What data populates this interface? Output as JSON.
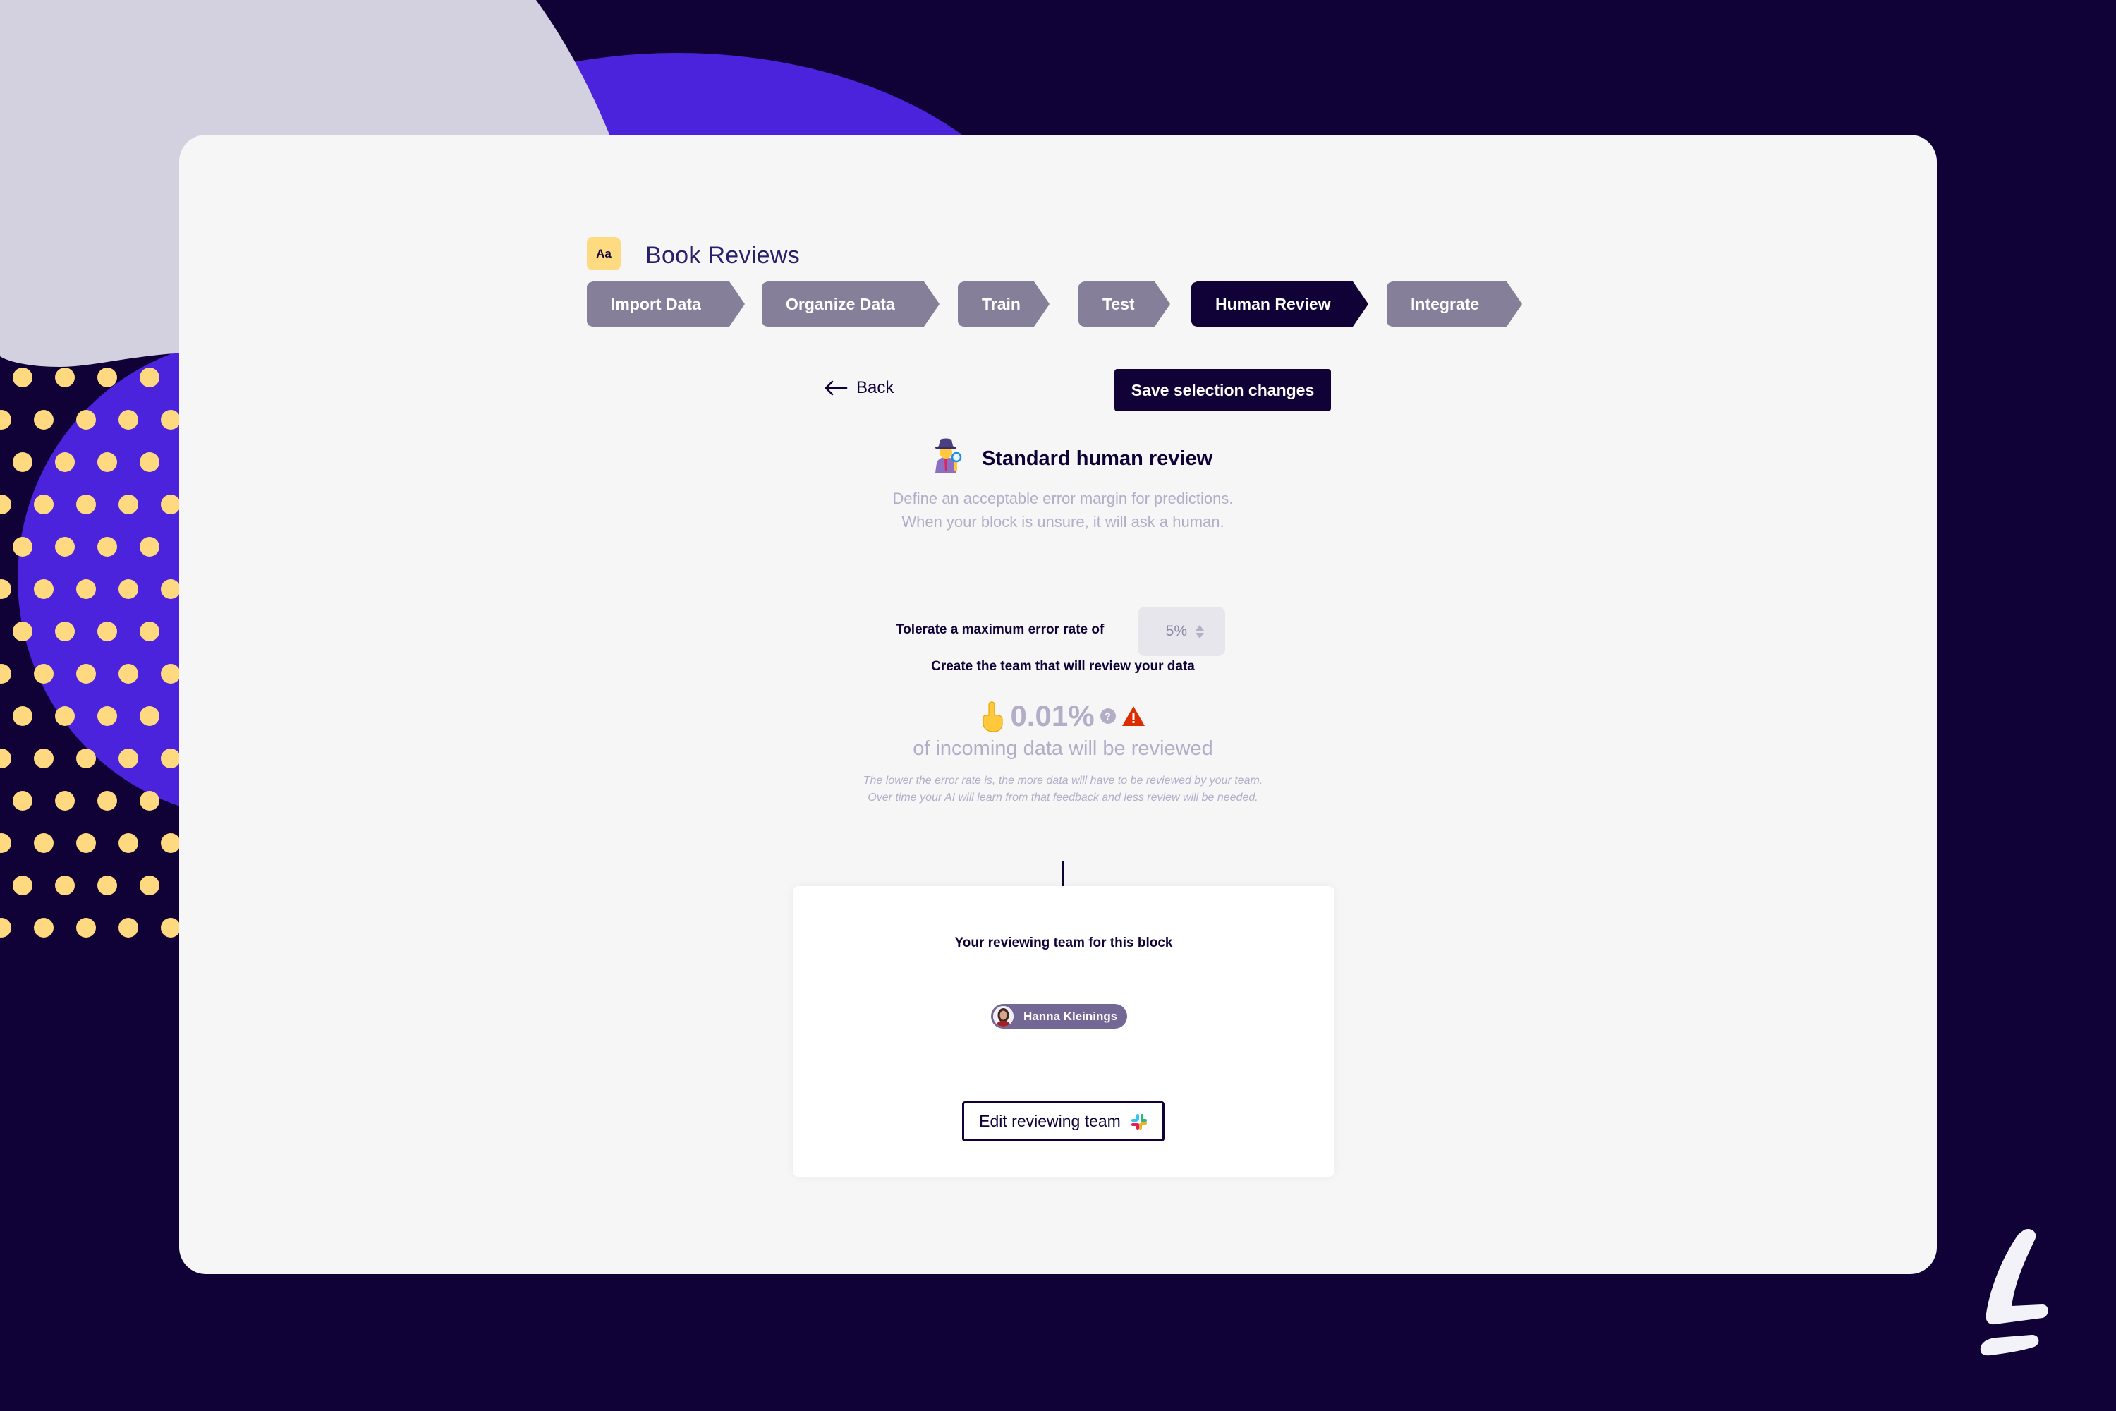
{
  "project": {
    "icon_label": "Aa",
    "title": "Book Reviews"
  },
  "steps": [
    {
      "label": "Import Data",
      "active": false
    },
    {
      "label": "Organize Data",
      "active": false
    },
    {
      "label": "Train",
      "active": false
    },
    {
      "label": "Test",
      "active": false
    },
    {
      "label": "Human Review",
      "active": true
    },
    {
      "label": "Integrate",
      "active": false
    }
  ],
  "toolbar": {
    "back_label": "Back",
    "save_label": "Save selection changes"
  },
  "review_mode": {
    "emoji": "🕵️‍♀️",
    "title": "Standard human review",
    "description_line1": "Define an acceptable error margin for predictions.",
    "description_line2": "When your block is unsure, it will ask a human."
  },
  "error_rate": {
    "label": "Tolerate a maximum error rate of",
    "value": "5%",
    "create_team_label": "Create the team that will review your data"
  },
  "estimate": {
    "emoji": "☝️",
    "percent": "0.01%",
    "help_glyph": "?",
    "caption": "of incoming data will be reviewed",
    "note": "The lower the error rate is, the more data will have to be reviewed by your team. Over time your AI will learn from that feedback and less review will be needed."
  },
  "team_panel": {
    "title": "Your reviewing team for this block",
    "members": [
      {
        "name": "Hanna Kleinings"
      }
    ],
    "edit_label": "Edit reviewing team"
  },
  "colors": {
    "background": "#100236",
    "accent_purple": "#4b23dc",
    "dot_yellow": "#fed97f",
    "blob_lavender": "#d3d0df",
    "step_inactive": "#867f99",
    "step_active": "#100236",
    "muted_text": "#b3adc8",
    "warning_red": "#dd2c00",
    "chip": "#736796"
  }
}
